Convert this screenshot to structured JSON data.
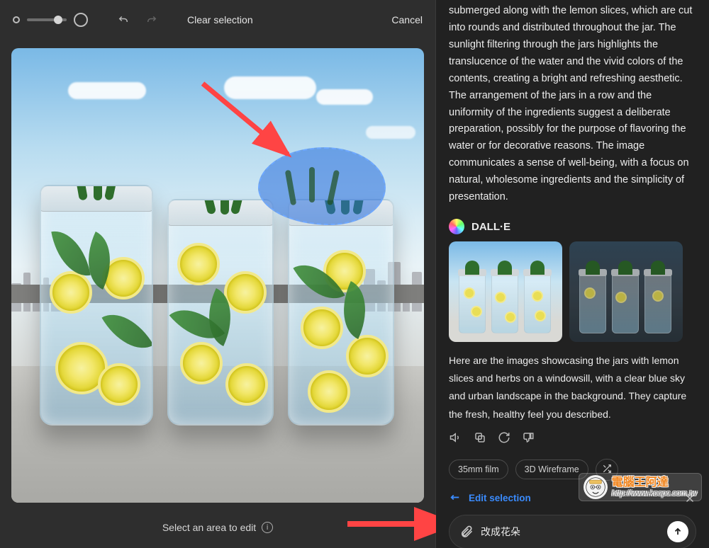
{
  "toolbar": {
    "clear_label": "Clear selection",
    "cancel_label": "Cancel"
  },
  "footer": {
    "hint": "Select an area to edit"
  },
  "description_text": "submerged along with the lemon slices, which are cut into rounds and distributed throughout the jar. The sunlight filtering through the jars highlights the translucence of the water and the vivid colors of the contents, creating a bright and refreshing aesthetic. The arrangement of the jars in a row and the uniformity of the ingredients suggest a deliberate preparation, possibly for the purpose of flavoring the water or for decorative reasons. The image communicates a sense of well-being, with a focus on natural, wholesome ingredients and the simplicity of presentation.",
  "assistant": {
    "name": "DALL·E",
    "result_text": "Here are the images showcasing the jars with lemon slices and herbs on a windowsill, with a clear blue sky and urban landscape in the background. They capture the fresh, healthy feel you described.",
    "thumbs": [
      "light",
      "dark"
    ]
  },
  "suggestions": {
    "chip1": "35mm film",
    "chip2": "3D Wireframe"
  },
  "edit_row": {
    "label": "Edit selection"
  },
  "input": {
    "value": "改成花朵"
  },
  "watermark": {
    "line1": "電腦王阿達",
    "line2": "http://www.kocpc.com.tw"
  }
}
